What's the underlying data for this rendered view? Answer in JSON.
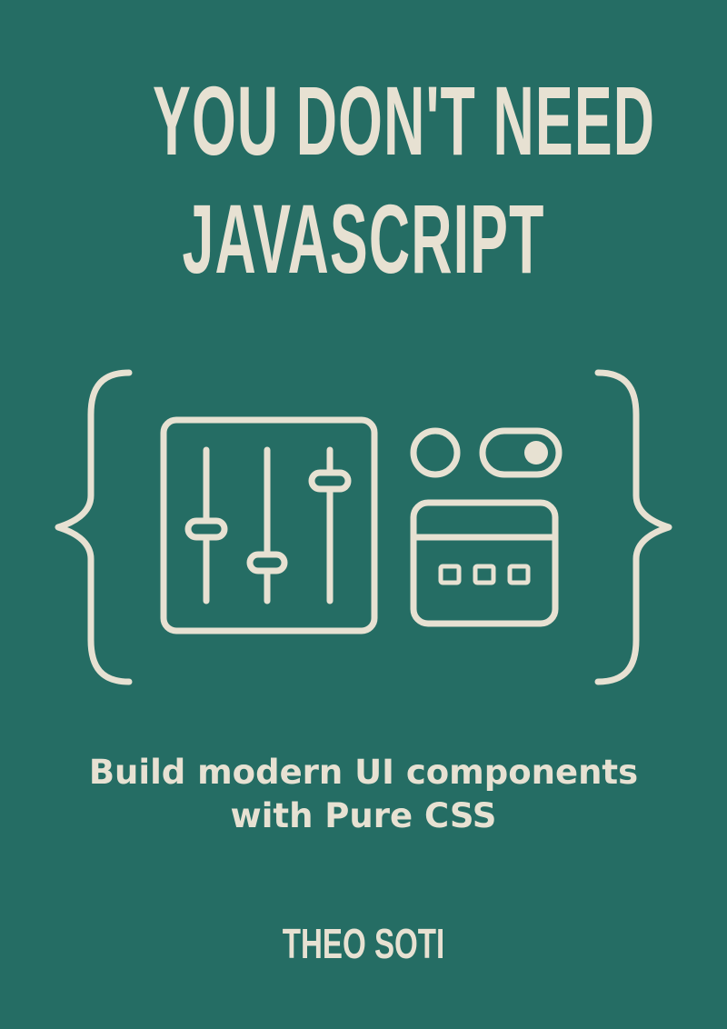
{
  "cover": {
    "title_lines": [
      "YOU DON'T NEED",
      "JAVASCRIPT"
    ],
    "subtitle_lines": [
      "Build modern UI components",
      "with Pure CSS"
    ],
    "author": "THEO SOTI"
  },
  "colors": {
    "background": "#256d64",
    "foreground": "#e7e1d2"
  },
  "icons": [
    "curly-brace-left-icon",
    "sliders-panel-icon",
    "radio-button-icon",
    "toggle-switch-icon",
    "browser-window-icon",
    "curly-brace-right-icon"
  ]
}
